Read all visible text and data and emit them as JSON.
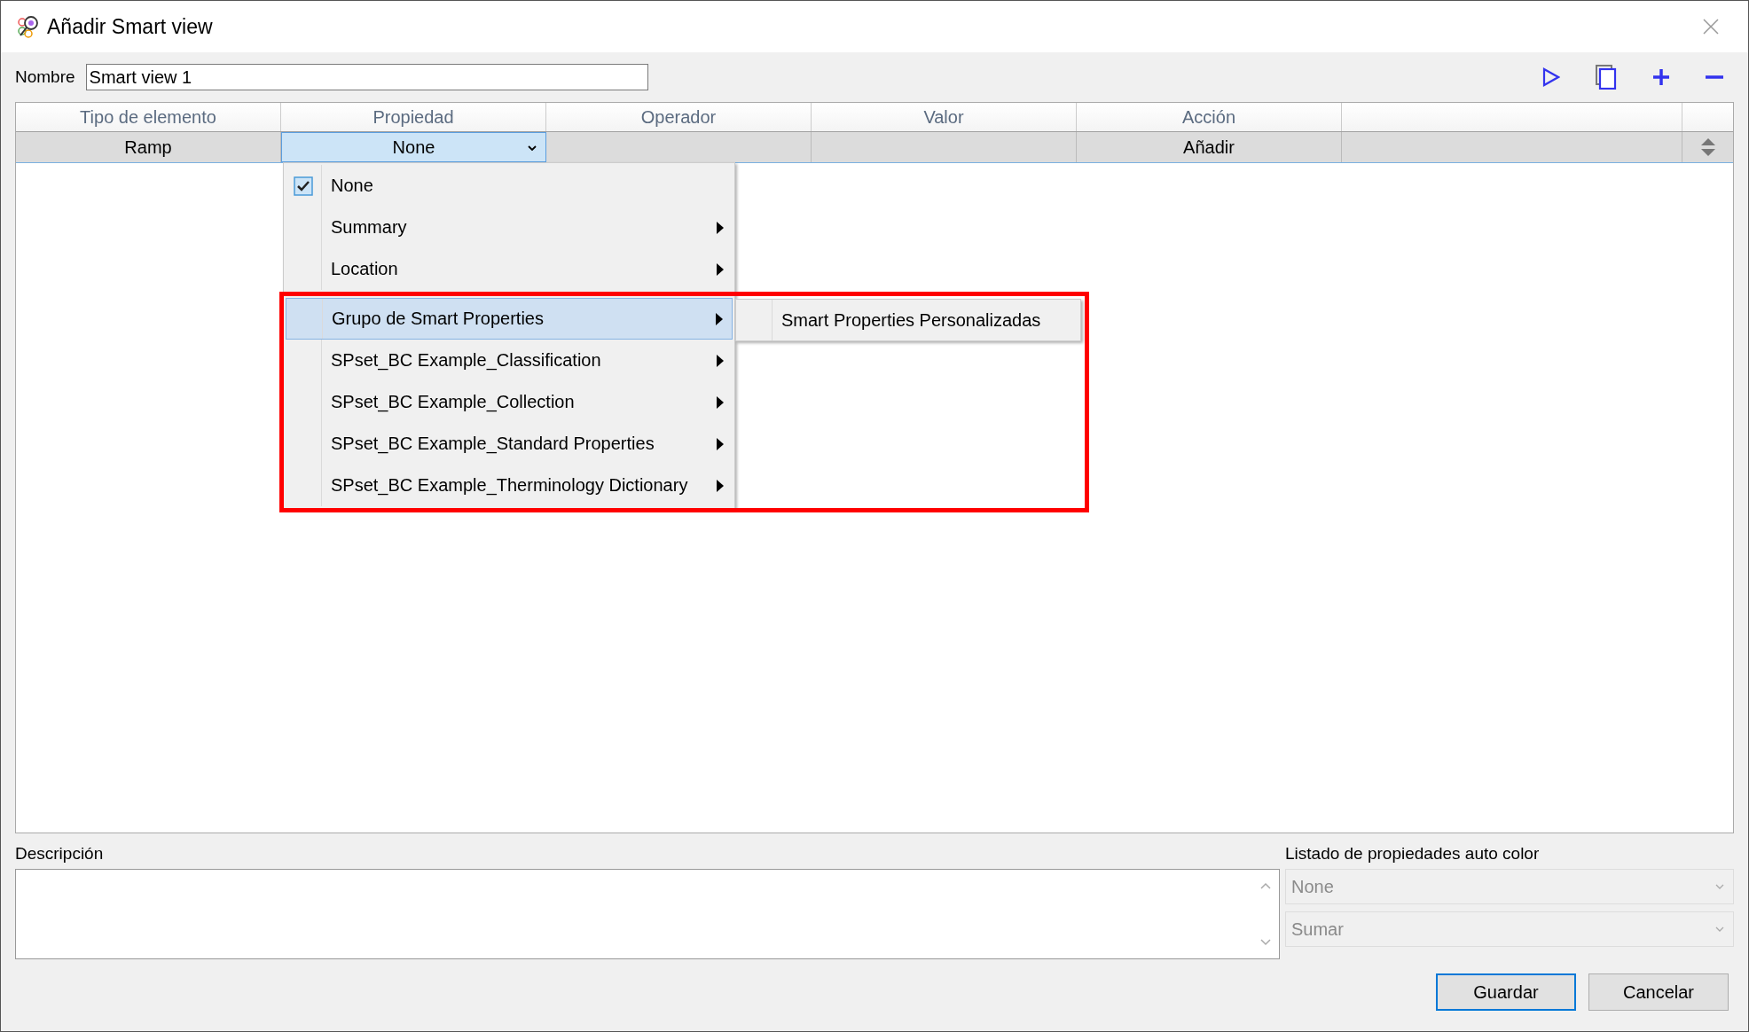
{
  "window": {
    "title": "Añadir Smart view"
  },
  "name_field": {
    "label": "Nombre",
    "value": "Smart view 1"
  },
  "table": {
    "columns": [
      "Tipo de elemento",
      "Propiedad",
      "Operador",
      "Valor",
      "Acción"
    ],
    "rows": [
      {
        "element_type": "Ramp",
        "property": "None",
        "operator": "",
        "value": "",
        "action": "Añadir",
        "selected": true
      }
    ]
  },
  "property_menu": {
    "items": [
      {
        "label": "None",
        "checked": true,
        "submenu": false,
        "selected": false,
        "separator_before": false
      },
      {
        "label": "Summary",
        "checked": false,
        "submenu": true,
        "selected": false,
        "separator_before": false
      },
      {
        "label": "Location",
        "checked": false,
        "submenu": true,
        "selected": false,
        "separator_before": false
      },
      {
        "label": "Grupo de Smart Properties",
        "checked": false,
        "submenu": true,
        "selected": true,
        "separator_before": true
      },
      {
        "label": "SPset_BC Example_Classification",
        "checked": false,
        "submenu": true,
        "selected": false,
        "separator_before": false
      },
      {
        "label": "SPset_BC Example_Collection",
        "checked": false,
        "submenu": true,
        "selected": false,
        "separator_before": false
      },
      {
        "label": "SPset_BC Example_Standard Properties",
        "checked": false,
        "submenu": true,
        "selected": false,
        "separator_before": false
      },
      {
        "label": "SPset_BC Example_Therminology Dictionary",
        "checked": false,
        "submenu": true,
        "selected": false,
        "separator_before": false
      }
    ],
    "submenu_items": [
      {
        "label": "Smart Properties Personalizadas"
      }
    ],
    "highlight_frame": true
  },
  "description": {
    "label": "Descripción"
  },
  "auto_color": {
    "label": "Listado de propiedades auto color",
    "dropdowns": [
      {
        "value": "None",
        "disabled": true
      },
      {
        "value": "Sumar",
        "disabled": true
      }
    ]
  },
  "buttons": [
    {
      "label": "Guardar",
      "default": true
    },
    {
      "label": "Cancelar",
      "default": false
    }
  ]
}
